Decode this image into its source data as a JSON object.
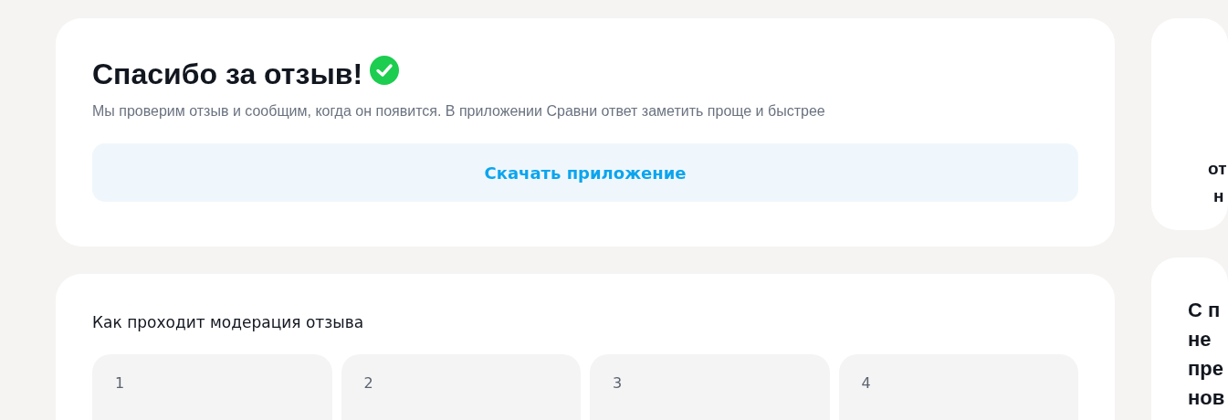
{
  "thanks_card": {
    "title": "Спасибо за отзыв!",
    "message": "Мы проверим отзыв и сообщим, когда он появится. В приложении Сравни ответ заметить проще и быстрее",
    "button": "Скачать приложение"
  },
  "moderation_card": {
    "title": "Как проходит модерация отзыва",
    "steps": [
      {
        "number": "1"
      },
      {
        "number": "2"
      },
      {
        "number": "3"
      },
      {
        "number": "4"
      }
    ]
  },
  "side_cards": [
    {
      "lines": [
        "от",
        "н"
      ]
    },
    {
      "lines": [
        "С п",
        "не",
        "пре",
        "нов"
      ]
    }
  ]
}
